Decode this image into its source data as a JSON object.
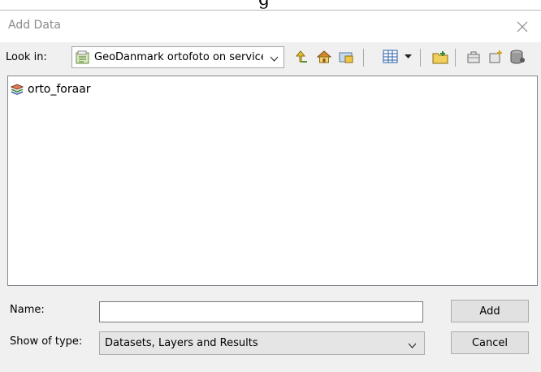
{
  "clipped_top_text": "g",
  "dialog": {
    "title": "Add Data"
  },
  "look_in": {
    "label": "Look in:",
    "value": "GeoDanmark ortofoto on service"
  },
  "toolbar": {
    "icons": [
      "up-one-level-icon",
      "go-home-icon",
      "connect-folder-icon",
      "view-menu-icon",
      "new-folder-icon",
      "new-toolbox-icon",
      "new-geodatabase-icon",
      "connect-database-icon"
    ]
  },
  "files": [
    {
      "name": "orto_foraar",
      "icon": "raster-layer-icon"
    }
  ],
  "name_field": {
    "label": "Name:",
    "value": "",
    "placeholder": ""
  },
  "show_of_type": {
    "label": "Show of type:",
    "value": "Datasets, Layers and Results"
  },
  "buttons": {
    "add": "Add",
    "cancel": "Cancel"
  },
  "colors": {
    "window_bg": "#f0f0f0",
    "title_text": "#8a8a8a",
    "button_bg": "#e1e1e1",
    "button_border": "#adadad"
  }
}
